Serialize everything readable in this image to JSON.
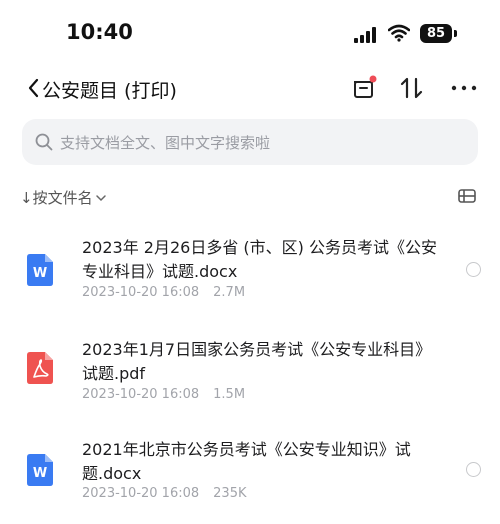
{
  "status_bar": {
    "time": "10:40",
    "battery": "85"
  },
  "nav": {
    "back_label": "<",
    "title": "公安题目 (打印)"
  },
  "search": {
    "placeholder": "支持文档全文、图中文字搜索啦"
  },
  "sort": {
    "label": "↓按文件名"
  },
  "files": [
    {
      "type": "word",
      "icon_letter": "W",
      "color": "#3a7bf2",
      "name": "2023年 2月26日多省 (市、区) 公务员考试《公安专业科目》试题.docx",
      "date": "2023-10-20 16:08",
      "size": "2.7M"
    },
    {
      "type": "pdf",
      "icon_letter": "",
      "color": "#ef5350",
      "name": "2023年1月7日国家公务员考试《公安专业科目》试题.pdf",
      "date": "2023-10-20 16:08",
      "size": "1.5M"
    },
    {
      "type": "word",
      "icon_letter": "W",
      "color": "#3a7bf2",
      "name": "2021年北京市公务员考试《公安专业知识》试题.docx",
      "date": "2023-10-20 16:08",
      "size": "235K"
    }
  ]
}
